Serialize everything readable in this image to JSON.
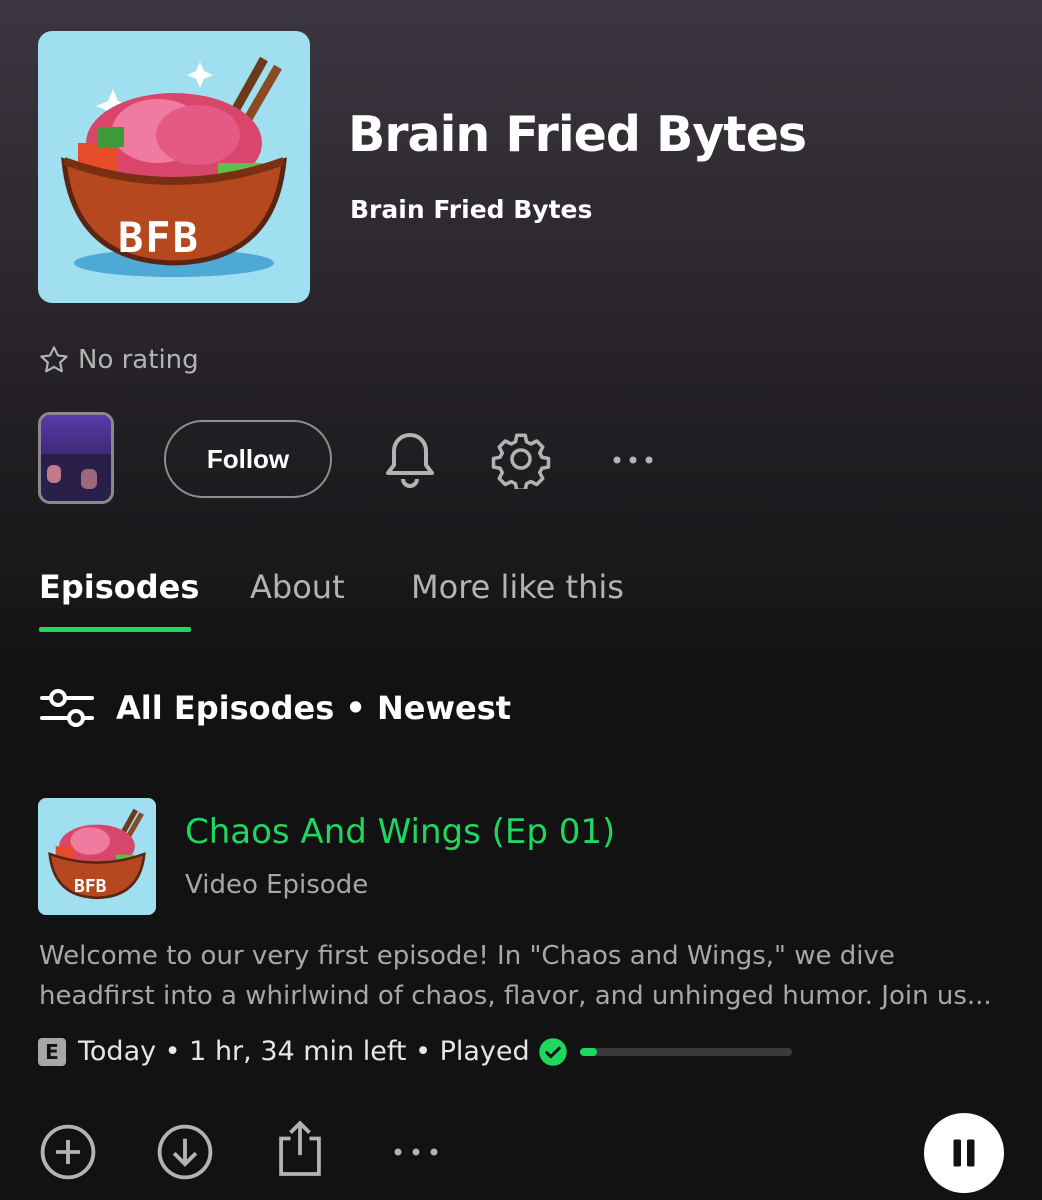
{
  "show": {
    "title": "Brain Fried Bytes",
    "author": "Brain Fried Bytes",
    "art_text": "BFB",
    "rating_text": "No rating"
  },
  "actions": {
    "follow_label": "Follow"
  },
  "tabs": [
    {
      "label": "Episodes",
      "active": true
    },
    {
      "label": "About",
      "active": false
    },
    {
      "label": "More like this",
      "active": false
    }
  ],
  "filter": {
    "label": "All Episodes • Newest"
  },
  "episode": {
    "title": "Chaos And Wings (Ep 01)",
    "type": "Video Episode",
    "art_text": "BFB",
    "description_line1": "Welcome to our very first episode! In \"Chaos and Wings,\" we dive",
    "description_line2": "headfirst into a whirlwind of chaos, flavor, and unhinged humor. Join us...",
    "explicit_badge": "E",
    "meta_text": "Today • 1 hr, 34 min left • Played",
    "progress_fraction": 0.08
  },
  "colors": {
    "accent": "#1ed760",
    "background": "#121212",
    "secondary_text": "#a7a7a7"
  }
}
